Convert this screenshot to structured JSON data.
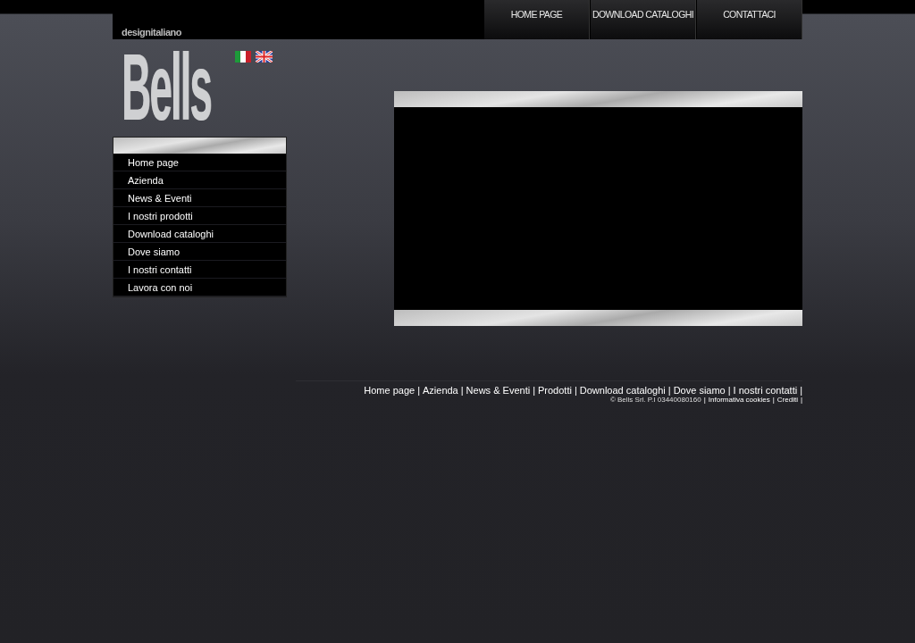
{
  "top_nav": [
    {
      "label": "HOME PAGE"
    },
    {
      "label": "DOWNLOAD CATALOGHI"
    },
    {
      "label": "CONTATTACI"
    }
  ],
  "logo": {
    "tagline": "designitaliano",
    "name": "Bells"
  },
  "languages": [
    {
      "kind": "italian"
    },
    {
      "kind": "english"
    }
  ],
  "side_menu": [
    {
      "label": "Home page"
    },
    {
      "label": "Azienda"
    },
    {
      "label": "News & Eventi"
    },
    {
      "label": "I nostri prodotti"
    },
    {
      "label": "Download cataloghi"
    },
    {
      "label": "Dove siamo"
    },
    {
      "label": "I nostri contatti"
    },
    {
      "label": "Lavora con noi"
    }
  ],
  "footer_links": [
    {
      "label": "Home page",
      "separator": "|"
    },
    {
      "label": "Azienda",
      "separator": "|"
    },
    {
      "label": "News & Eventi",
      "separator": "|"
    },
    {
      "label": "Prodotti",
      "separator": "|"
    },
    {
      "label": "Download cataloghi",
      "separator": "|"
    },
    {
      "label": "Dove siamo",
      "separator": "|"
    },
    {
      "label": "I nostri contatti",
      "separator": "|"
    }
  ],
  "footer_legal": [
    {
      "kind": "text",
      "label": "© Bells Srl. P.I 03440080160",
      "separator": "|"
    },
    {
      "kind": "link",
      "label": "Informativa cookies",
      "separator": "|"
    },
    {
      "kind": "link",
      "label": "Crediti",
      "separator": "|"
    }
  ]
}
